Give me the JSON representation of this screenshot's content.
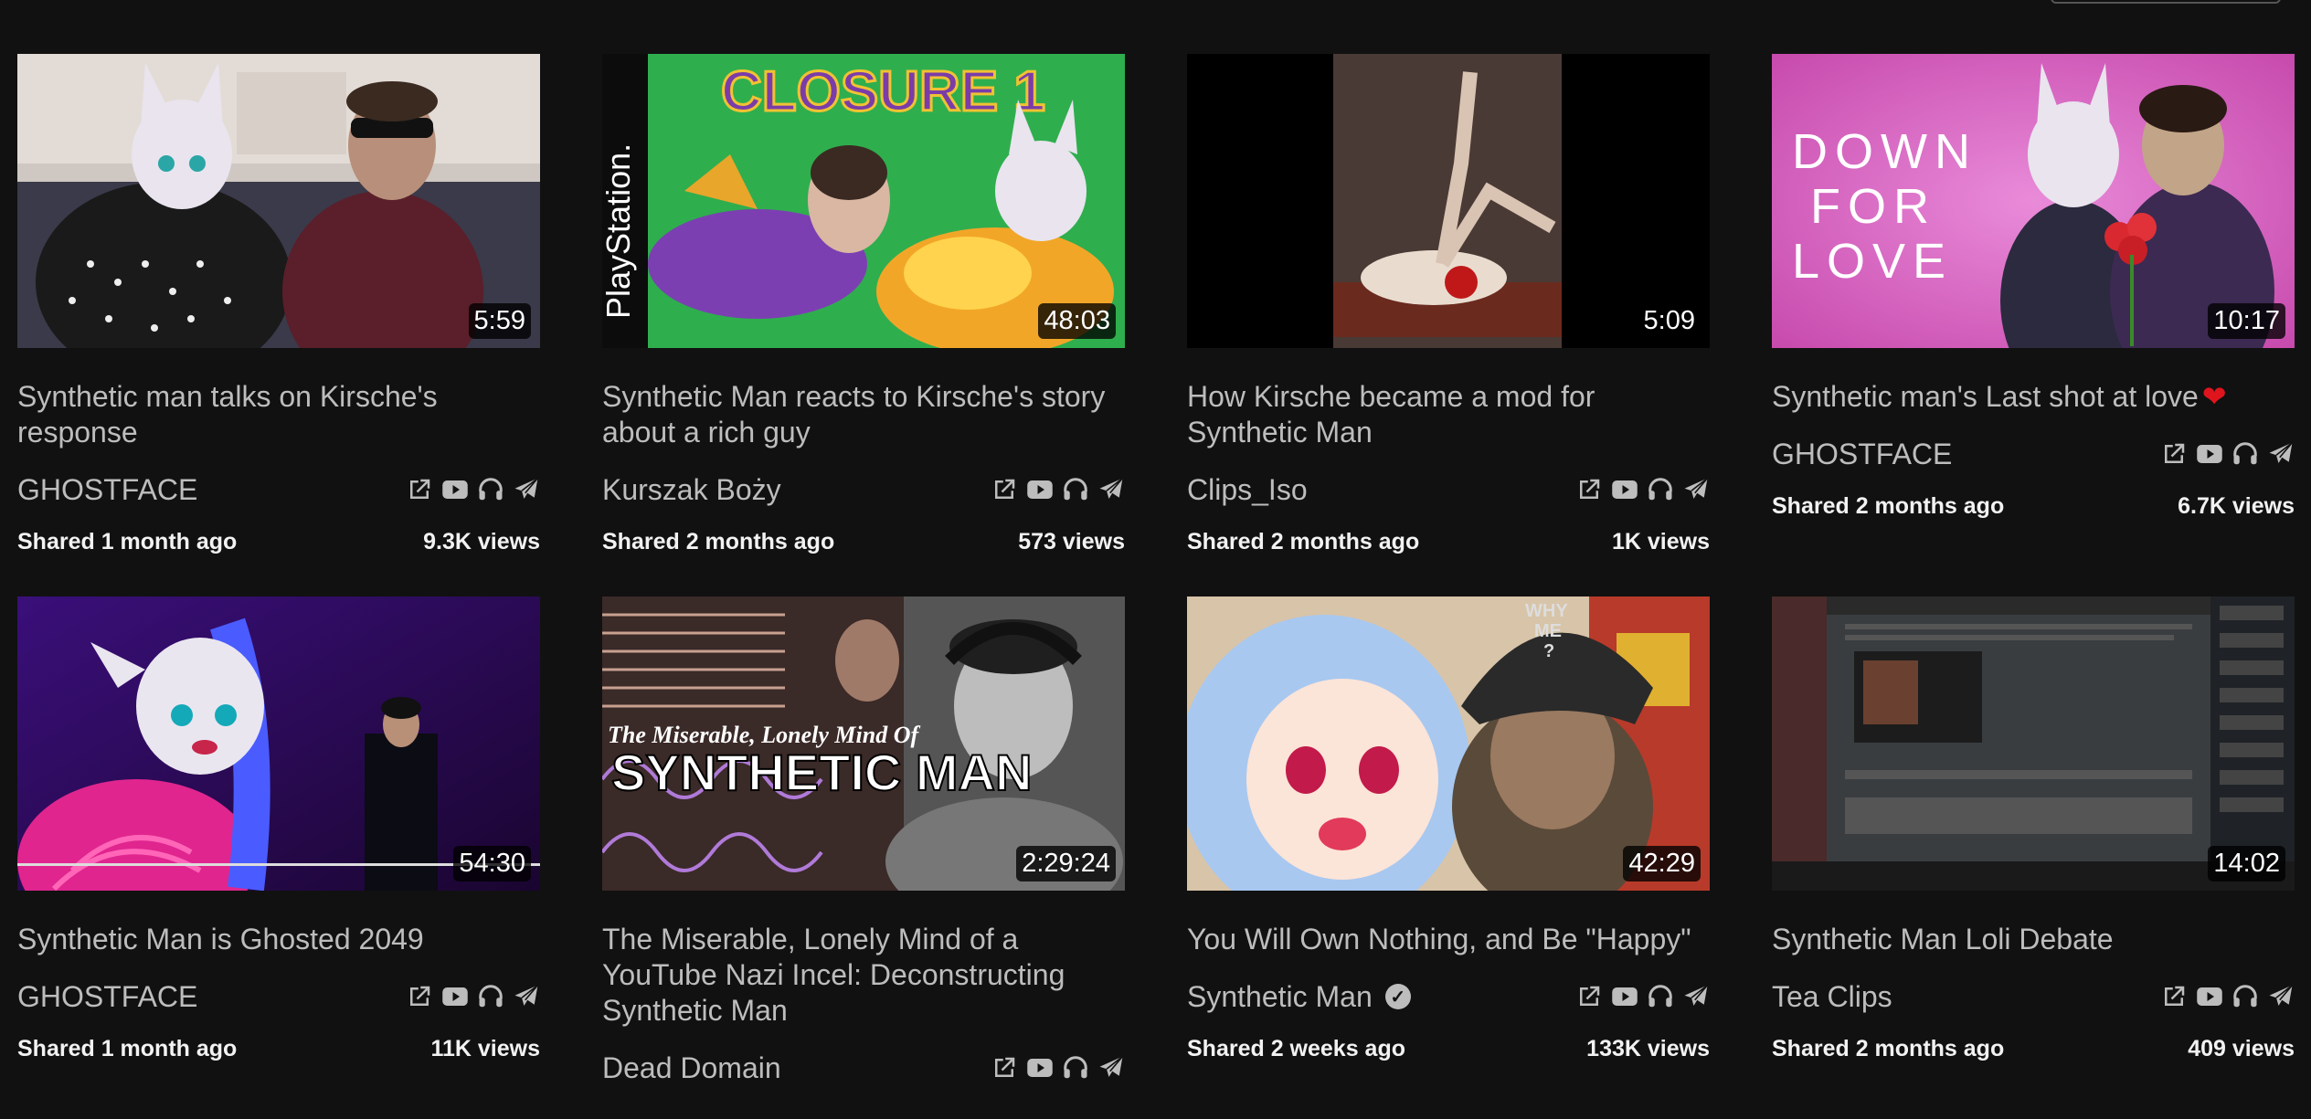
{
  "videos": [
    {
      "title": "Synthetic man talks on Kirsche's response",
      "channel": "GHOSTFACE",
      "duration": "5:59",
      "shared": "Shared 1 month ago",
      "views": "9.3K views"
    },
    {
      "title": "Synthetic Man reacts to Kirsche's story about a rich guy",
      "channel": "Kurszak Boży",
      "duration": "48:03",
      "shared": "Shared 2 months ago",
      "views": "573 views",
      "thumb_text": "CLOSURE 1",
      "side_text": "PlayStation."
    },
    {
      "title": "How Kirsche became a mod for Synthetic Man",
      "channel": "Clips_Iso",
      "duration": "5:09",
      "shared": "Shared 2 months ago",
      "views": "1K views"
    },
    {
      "title": "Synthetic man's Last shot at love",
      "title_suffix": "❤",
      "channel": "GHOSTFACE",
      "duration": "10:17",
      "shared": "Shared 2 months ago",
      "views": "6.7K views",
      "thumb_text_lines": [
        "DOWN",
        "FOR",
        "LOVE"
      ]
    },
    {
      "title": "Synthetic Man is Ghosted 2049",
      "channel": "GHOSTFACE",
      "duration": "54:30",
      "shared": "Shared 1 month ago",
      "views": "11K views"
    },
    {
      "title": "The Miserable, Lonely Mind of a YouTube Nazi Incel: Deconstructing Synthetic Man",
      "channel": "Dead Domain",
      "duration": "2:29:24",
      "thumb_text_small": "The Miserable, Lonely Mind Of",
      "thumb_text_big": "SYNTHETIC MAN"
    },
    {
      "title": "You Will Own Nothing, and Be \"Happy\"",
      "channel": "Synthetic Man",
      "duration": "42:29",
      "shared": "Shared 2 weeks ago",
      "views": "133K views",
      "thumb_text_lines": [
        "WHY",
        "ME",
        "?"
      ]
    },
    {
      "title": "Synthetic Man Loli Debate",
      "channel": "Tea Clips",
      "duration": "14:02",
      "shared": "Shared 2 months ago",
      "views": "409 views"
    }
  ],
  "icons": {
    "open": "external-link-icon",
    "youtube": "youtube-icon",
    "audio": "headphones-icon",
    "telegram": "paper-plane-icon"
  },
  "colors": {
    "background": "#111111",
    "text_muted": "#bdbdbd",
    "text_bright": "#f2f2f2",
    "heart": "#e0141d"
  }
}
